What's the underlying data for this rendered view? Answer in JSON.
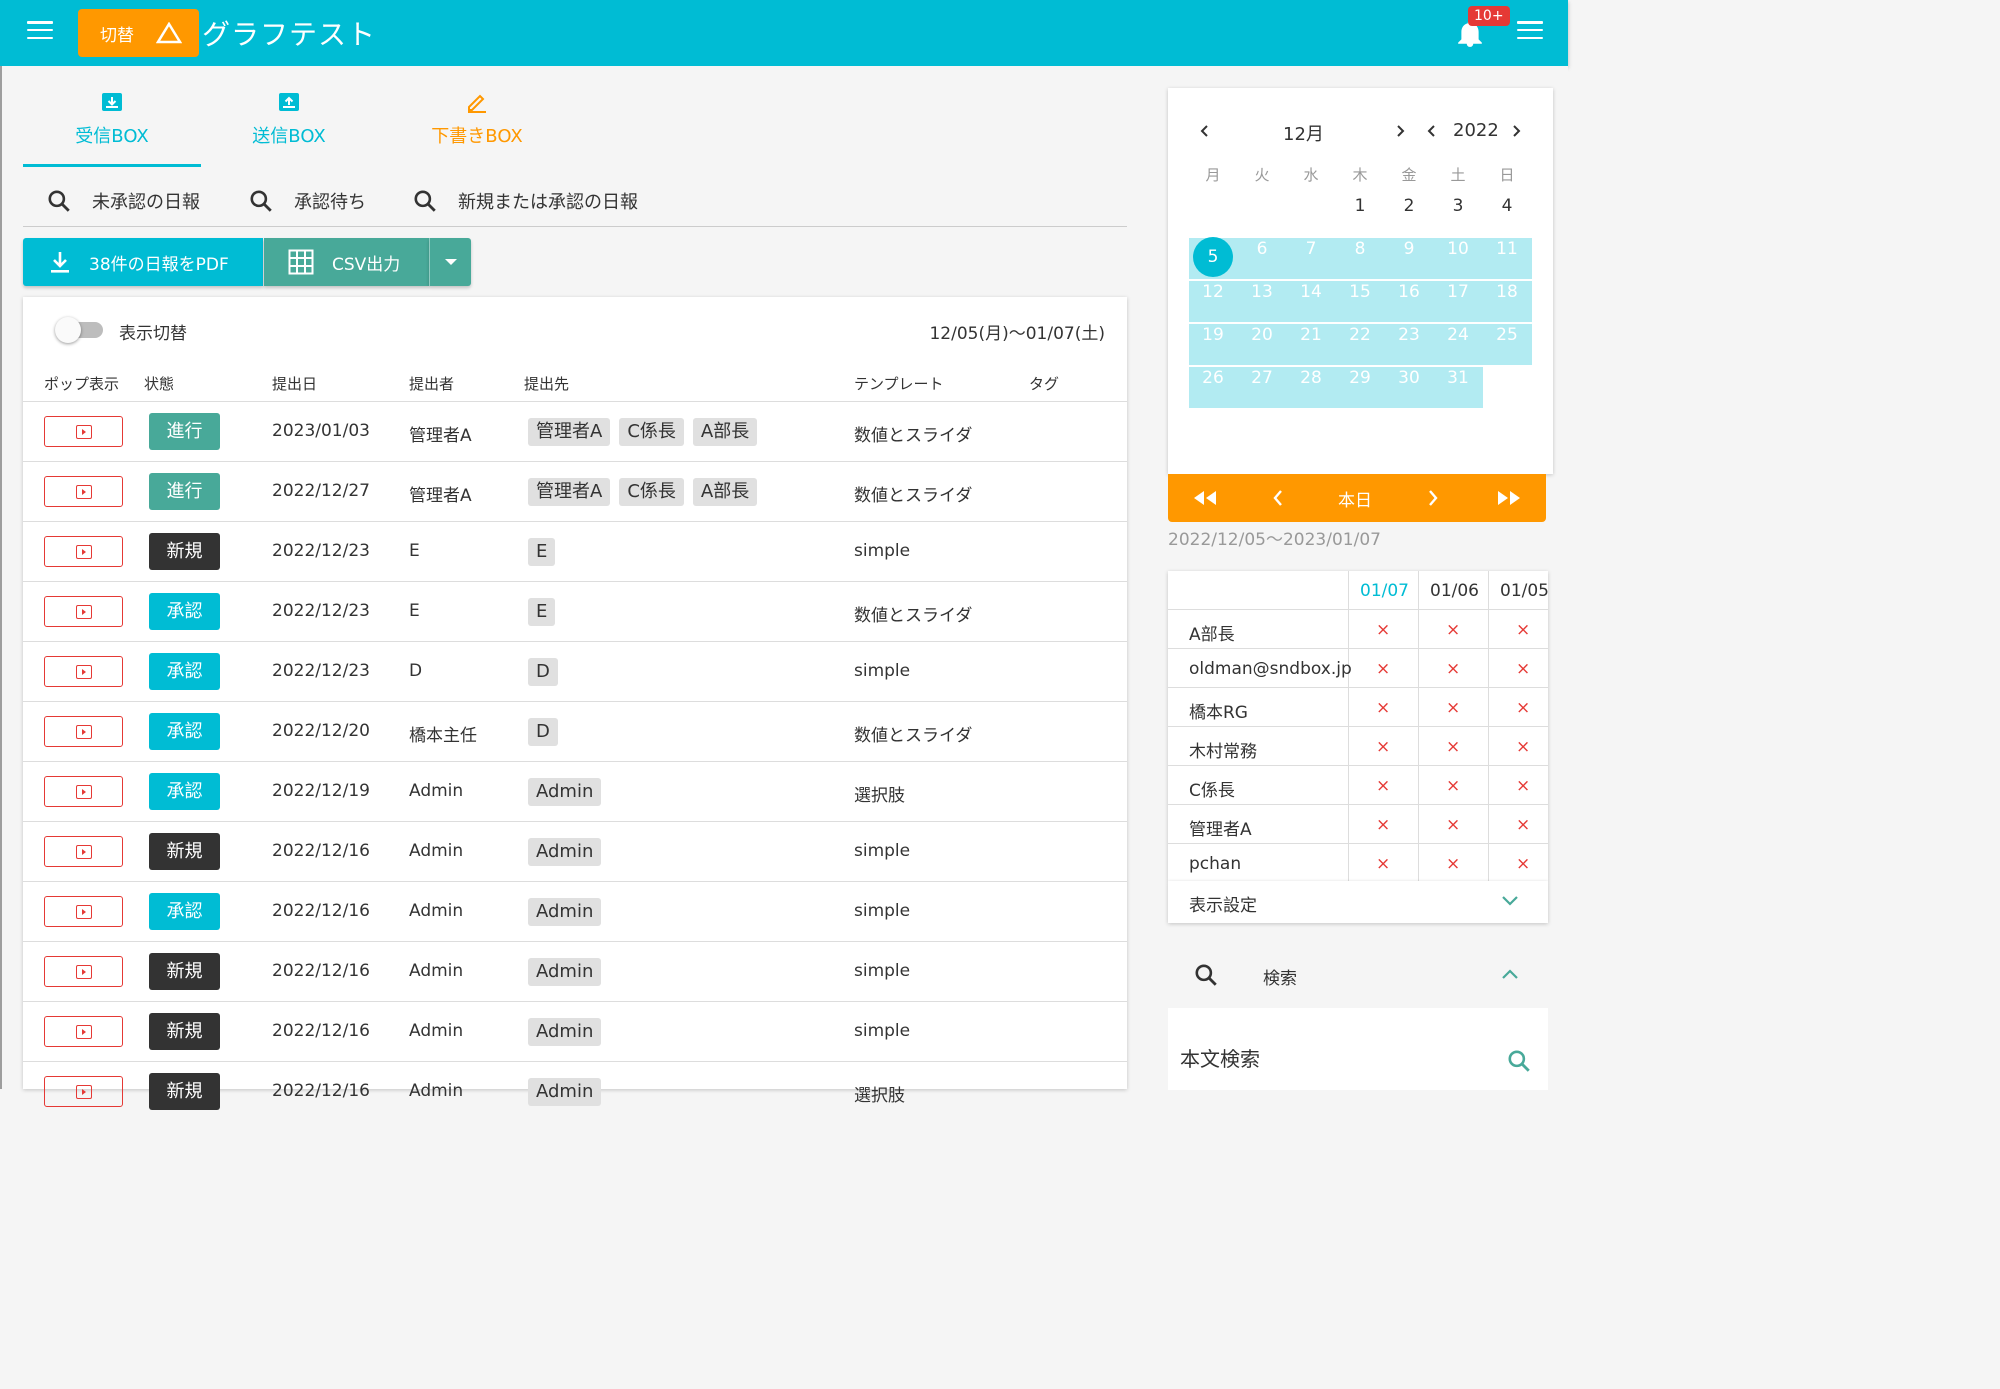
{
  "header": {
    "switch_label": "切替",
    "app_title": "グラフテスト",
    "notification_badge": "10+"
  },
  "tabs": [
    {
      "label": "受信BOX",
      "color": "#00bcd4"
    },
    {
      "label": "送信BOX",
      "color": "#00bcd4"
    },
    {
      "label": "下書きBOX",
      "color": "#ff9800"
    }
  ],
  "filters": [
    "未承認の日報",
    "承認待ち",
    "新規または承認の日報"
  ],
  "actions": {
    "pdf_label": "38件の日報をPDF",
    "csv_label": "CSV出力"
  },
  "list": {
    "toggle_label": "表示切替",
    "range": "12/05(月)〜01/07(土)",
    "columns": [
      "ポップ表示",
      "状態",
      "提出日",
      "提出者",
      "提出先",
      "テンプレート",
      "タグ"
    ],
    "rows": [
      {
        "status": "進行",
        "status_type": "green",
        "date": "2023/01/03",
        "submitter": "管理者A",
        "recipients": [
          "管理者A",
          "C係長",
          "A部長"
        ],
        "template": "数値とスライダ"
      },
      {
        "status": "進行",
        "status_type": "green",
        "date": "2022/12/27",
        "submitter": "管理者A",
        "recipients": [
          "管理者A",
          "C係長",
          "A部長"
        ],
        "template": "数値とスライダ"
      },
      {
        "status": "新規",
        "status_type": "dark",
        "date": "2022/12/23",
        "submitter": "E",
        "recipients": [
          "E"
        ],
        "template": "simple"
      },
      {
        "status": "承認",
        "status_type": "cyan",
        "date": "2022/12/23",
        "submitter": "E",
        "recipients": [
          "E"
        ],
        "template": "数値とスライダ"
      },
      {
        "status": "承認",
        "status_type": "cyan",
        "date": "2022/12/23",
        "submitter": "D",
        "recipients": [
          "D"
        ],
        "template": "simple"
      },
      {
        "status": "承認",
        "status_type": "cyan",
        "date": "2022/12/20",
        "submitter": "橋本主任",
        "recipients": [
          "D"
        ],
        "template": "数値とスライダ"
      },
      {
        "status": "承認",
        "status_type": "cyan",
        "date": "2022/12/19",
        "submitter": "Admin",
        "recipients": [
          "Admin"
        ],
        "template": "選択肢"
      },
      {
        "status": "新規",
        "status_type": "dark",
        "date": "2022/12/16",
        "submitter": "Admin",
        "recipients": [
          "Admin"
        ],
        "template": "simple"
      },
      {
        "status": "承認",
        "status_type": "cyan",
        "date": "2022/12/16",
        "submitter": "Admin",
        "recipients": [
          "Admin"
        ],
        "template": "simple"
      },
      {
        "status": "新規",
        "status_type": "dark",
        "date": "2022/12/16",
        "submitter": "Admin",
        "recipients": [
          "Admin"
        ],
        "template": "simple"
      },
      {
        "status": "新規",
        "status_type": "dark",
        "date": "2022/12/16",
        "submitter": "Admin",
        "recipients": [
          "Admin"
        ],
        "template": "simple"
      },
      {
        "status": "新規",
        "status_type": "dark",
        "date": "2022/12/16",
        "submitter": "Admin",
        "recipients": [
          "Admin"
        ],
        "template": "選択肢"
      }
    ]
  },
  "calendar": {
    "month": "12月",
    "year": "2022",
    "weekdays": [
      "月",
      "火",
      "水",
      "木",
      "金",
      "土",
      "日"
    ],
    "selected_day": "5",
    "today_label": "本日"
  },
  "selected_range": "2022/12/05〜2023/01/07",
  "attendance": {
    "dates": [
      "01/07",
      "01/06",
      "01/05"
    ],
    "people": [
      "A部長",
      "oldman@sndbox.jp",
      "橋本RG",
      "木村常務",
      "C係長",
      "管理者A",
      "pchan"
    ],
    "mark": "×"
  },
  "display_settings_label": "表示設定",
  "search": {
    "label": "検索",
    "body_search_label": "本文検索"
  }
}
